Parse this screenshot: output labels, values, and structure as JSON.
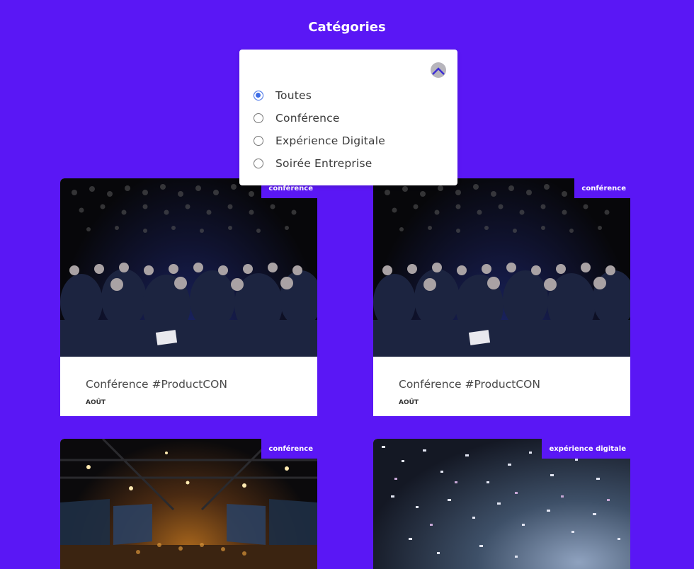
{
  "page": {
    "title": "Catégories"
  },
  "filter": {
    "options": [
      {
        "label": "Toutes",
        "checked": true
      },
      {
        "label": "Conférence",
        "checked": false
      },
      {
        "label": "Expérience Digitale",
        "checked": false
      },
      {
        "label": "Soirée Entreprise",
        "checked": false
      }
    ]
  },
  "cards": [
    {
      "badge": "conférence",
      "title": "Conférence #ProductCON",
      "date": "AOÛT"
    },
    {
      "badge": "conférence",
      "title": "Conférence #ProductCON",
      "date": "AOÛT"
    },
    {
      "badge": "conférence"
    },
    {
      "badge": "expérience digitale"
    }
  ],
  "colors": {
    "background": "#5a17f5",
    "radio_accent": "#3d6ce6",
    "card": "#ffffff"
  }
}
